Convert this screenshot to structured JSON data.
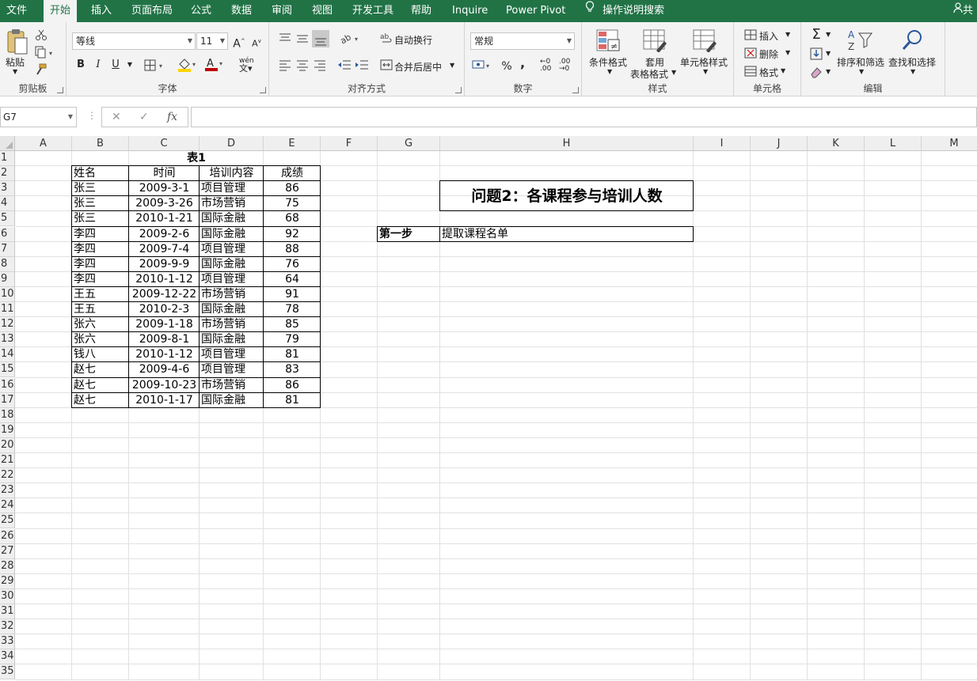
{
  "tabs": [
    "文件",
    "开始",
    "插入",
    "页面布局",
    "公式",
    "数据",
    "审阅",
    "视图",
    "开发工具",
    "帮助",
    "Inquire",
    "Power Pivot"
  ],
  "tell_me": "操作说明搜索",
  "share": "共",
  "ribbon": {
    "clipboard": {
      "label": "剪贴板",
      "paste": "粘贴"
    },
    "font": {
      "label": "字体",
      "name": "等线",
      "size": "11",
      "bold": "B",
      "italic": "I",
      "underline": "U",
      "grow": "A",
      "shrink": "A",
      "font_color_letter": "A",
      "phonetic": "wén"
    },
    "alignment": {
      "label": "对齐方式",
      "wrap": "自动换行",
      "merge": "合并后居中"
    },
    "number": {
      "label": "数字",
      "format": "常规",
      "percent": "%",
      "comma": ",",
      "inc_dec": ".00",
      "dec_dec": ".00"
    },
    "styles": {
      "label": "样式",
      "conditional": "条件格式",
      "table_a": "套用",
      "table_b": "表格格式",
      "cell_styles": "单元格样式"
    },
    "cells": {
      "label": "单元格",
      "insert": "插入",
      "delete": "删除",
      "format": "格式"
    },
    "editing": {
      "label": "编辑",
      "sort": "排序和筛选",
      "find": "查找和选择",
      "sigma": "Σ"
    }
  },
  "formula_bar": {
    "name_box": "G7",
    "fx": "fx",
    "cancel": "✕",
    "enter": "✓",
    "value": ""
  },
  "columns": [
    "A",
    "B",
    "C",
    "D",
    "E",
    "F",
    "G",
    "H",
    "I",
    "J",
    "K",
    "L",
    "M"
  ],
  "rows": [
    "1",
    "2",
    "3",
    "4",
    "5",
    "6",
    "7",
    "8",
    "9",
    "10",
    "11",
    "12",
    "13",
    "14",
    "15",
    "16",
    "17",
    "18",
    "19",
    "20",
    "21",
    "22",
    "23",
    "24",
    "25",
    "26",
    "27",
    "28",
    "29",
    "30",
    "31",
    "32",
    "33",
    "34",
    "35"
  ],
  "table1": {
    "title": "表1",
    "headers": [
      "姓名",
      "时间",
      "培训内容",
      "成绩"
    ],
    "rows": [
      [
        "张三",
        "2009-3-1",
        "项目管理",
        "86"
      ],
      [
        "张三",
        "2009-3-26",
        "市场营销",
        "75"
      ],
      [
        "张三",
        "2010-1-21",
        "国际金融",
        "68"
      ],
      [
        "李四",
        "2009-2-6",
        "国际金融",
        "92"
      ],
      [
        "李四",
        "2009-7-4",
        "项目管理",
        "88"
      ],
      [
        "李四",
        "2009-9-9",
        "国际金融",
        "76"
      ],
      [
        "李四",
        "2010-1-12",
        "项目管理",
        "64"
      ],
      [
        "王五",
        "2009-12-22",
        "市场营销",
        "91"
      ],
      [
        "王五",
        "2010-2-3",
        "国际金融",
        "78"
      ],
      [
        "张六",
        "2009-1-18",
        "市场营销",
        "85"
      ],
      [
        "张六",
        "2009-8-1",
        "国际金融",
        "79"
      ],
      [
        "钱八",
        "2010-1-12",
        "项目管理",
        "81"
      ],
      [
        "赵七",
        "2009-4-6",
        "项目管理",
        "83"
      ],
      [
        "赵七",
        "2009-10-23",
        "市场营销",
        "86"
      ],
      [
        "赵七",
        "2010-1-17",
        "国际金融",
        "81"
      ]
    ]
  },
  "question": {
    "title": "问题2：各课程参与培训人数",
    "step_label": "第一步",
    "step_text": "提取课程名单"
  }
}
